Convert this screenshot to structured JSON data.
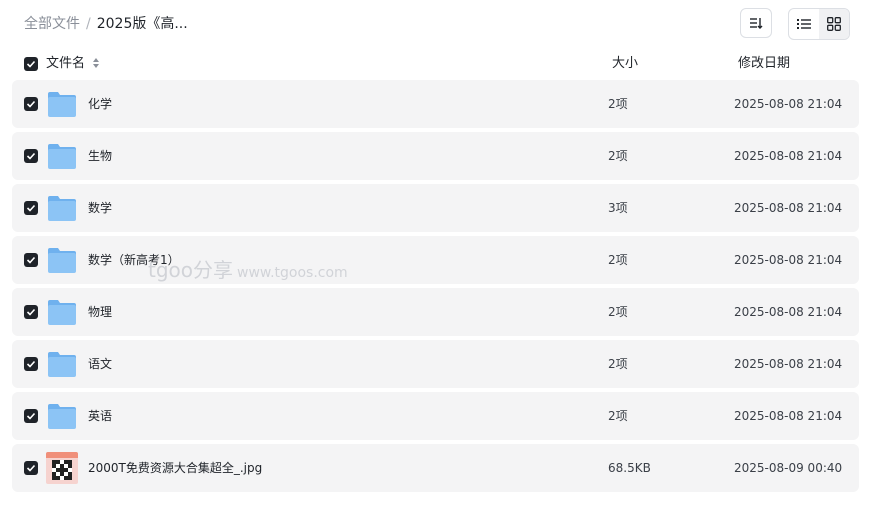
{
  "breadcrumb": {
    "root": "全部文件",
    "separator": "/",
    "current": "2025版《高..."
  },
  "columns": {
    "name": "文件名",
    "size": "大小",
    "modified": "修改日期"
  },
  "watermark": {
    "brand": "tgoo分享",
    "site": "www.tgoos.com"
  },
  "files": [
    {
      "name": "化学",
      "size": "2项",
      "date": "2025-08-08 21:04",
      "type": "folder"
    },
    {
      "name": "生物",
      "size": "2项",
      "date": "2025-08-08 21:04",
      "type": "folder"
    },
    {
      "name": "数学",
      "size": "3项",
      "date": "2025-08-08 21:04",
      "type": "folder"
    },
    {
      "name": "数学（新高考1）",
      "size": "2项",
      "date": "2025-08-08 21:04",
      "type": "folder"
    },
    {
      "name": "物理",
      "size": "2项",
      "date": "2025-08-08 21:04",
      "type": "folder"
    },
    {
      "name": "语文",
      "size": "2项",
      "date": "2025-08-08 21:04",
      "type": "folder"
    },
    {
      "name": "英语",
      "size": "2项",
      "date": "2025-08-08 21:04",
      "type": "folder"
    },
    {
      "name": "2000T免费资源大合集超全_.jpg",
      "size": "68.5KB",
      "date": "2025-08-09 00:40",
      "type": "image"
    }
  ],
  "colors": {
    "folder": "#8cc4f5",
    "folder_tab": "#6fb1ee",
    "checkbox": "#1f2329",
    "row_bg": "#f4f4f5"
  },
  "icons": {
    "sort": "sort-icon",
    "list_view": "list-view-icon",
    "grid_view": "grid-view-icon",
    "folder": "folder-icon",
    "image": "image-thumbnail-icon"
  }
}
